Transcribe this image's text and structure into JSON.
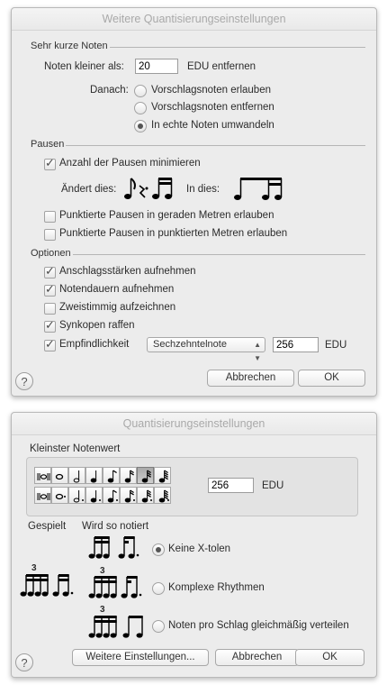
{
  "window1": {
    "title": "Weitere Quantisierungseinstellungen",
    "short_notes": {
      "heading": "Sehr kurze Noten",
      "smaller_label": "Noten kleiner als:",
      "smaller_value": "20",
      "edu_remove": "EDU entfernen",
      "after_label": "Danach:",
      "options": [
        "Vorschlagsnoten erlauben",
        "Vorschlagsnoten entfernen",
        "In echte Noten umwandeln"
      ],
      "selected_index": 2
    },
    "rests": {
      "heading": "Pausen",
      "minimize_label": "Anzahl der Pausen minimieren",
      "minimize_checked": true,
      "changes_label": "Ändert dies:",
      "into_label": "In dies:",
      "dotted_even_label": "Punktierte Pausen in geraden Metren erlauben",
      "dotted_even_checked": false,
      "dotted_dotted_label": "Punktierte Pausen in punktierten Metren erlauben",
      "dotted_dotted_checked": false
    },
    "options": {
      "heading": "Optionen",
      "velocities_label": "Anschlagsstärken aufnehmen",
      "velocities_checked": true,
      "durations_label": "Notendauern aufnehmen",
      "durations_checked": true,
      "twovoice_label": "Zweistimmig aufzeichnen",
      "twovoice_checked": false,
      "syncopation_label": "Synkopen raffen",
      "syncopation_checked": true,
      "sensitivity_label": "Empfindlichkeit",
      "sensitivity_checked": true,
      "sensitivity_select": "Sechzehntelnote",
      "sensitivity_value": "256",
      "sensitivity_unit": "EDU"
    },
    "buttons": {
      "cancel": "Abbrechen",
      "ok": "OK",
      "help": "?"
    }
  },
  "window2": {
    "title": "Quantisierungseinstellungen",
    "smallest_heading": "Kleinster Notenwert",
    "selected_cell": 6,
    "edu_value": "256",
    "edu_unit": "EDU",
    "played_label": "Gespielt",
    "notated_label": "Wird so notiert",
    "tuplet_number": "3",
    "tuplet_options": [
      "Keine X-tolen",
      "Komplexe Rhythmen",
      "Noten pro Schlag gleichmäßig verteilen"
    ],
    "tuplet_selected_index": 0,
    "buttons": {
      "more": "Weitere Einstellungen...",
      "cancel": "Abbrechen",
      "ok": "OK",
      "help": "?"
    }
  }
}
